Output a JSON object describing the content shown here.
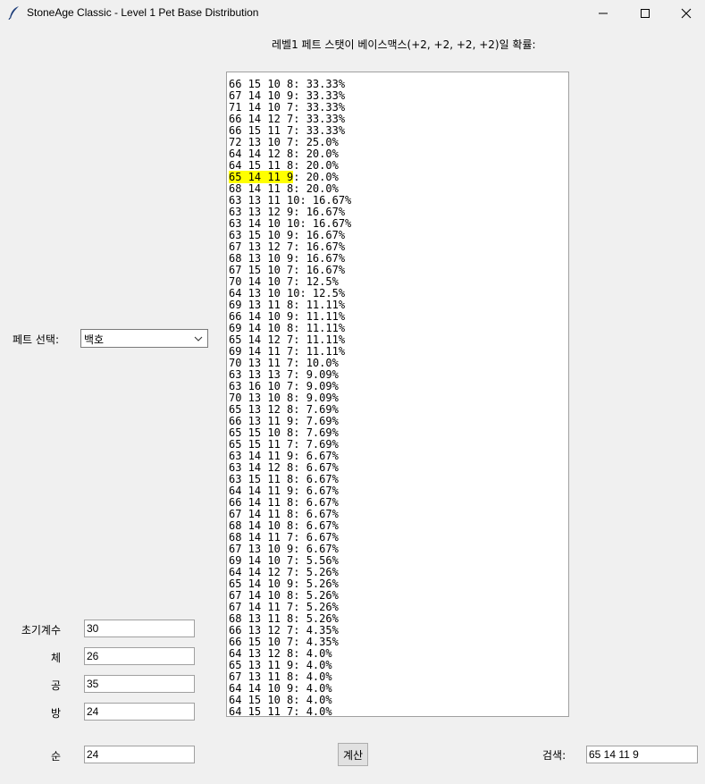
{
  "window": {
    "title": "StoneAge Classic - Level 1 Pet Base Distribution",
    "app_icon": "feather-icon"
  },
  "heading": "레벨1 페트 스탯이 베이스맥스(+2, +2, +2, +2)일 확률:",
  "pet_select": {
    "label": "페트 선택:",
    "value": "백호"
  },
  "fields": {
    "init_coef": {
      "label": "초기계수",
      "value": "30"
    },
    "vit": {
      "label": "체",
      "value": "26"
    },
    "atk": {
      "label": "공",
      "value": "35"
    },
    "def": {
      "label": "방",
      "value": "24"
    },
    "agi": {
      "label": "순",
      "value": "24"
    }
  },
  "calc_button": "계산",
  "search": {
    "label": "검색:",
    "value": "65 14 11 9"
  },
  "highlight_color": "#ffff00",
  "results": [
    "66 15 10 8: 33.33%",
    "67 14 10 9: 33.33%",
    "71 14 10 7: 33.33%",
    "66 14 12 7: 33.33%",
    "66 15 11 7: 33.33%",
    "72 13 10 7: 25.0%",
    "64 14 12 8: 20.0%",
    "64 15 11 8: 20.0%",
    "65 14 11 9: 20.0%",
    "68 14 11 8: 20.0%",
    "63 13 11 10: 16.67%",
    "63 13 12 9: 16.67%",
    "63 14 10 10: 16.67%",
    "63 15 10 9: 16.67%",
    "67 13 12 7: 16.67%",
    "68 13 10 9: 16.67%",
    "67 15 10 7: 16.67%",
    "70 14 10 7: 12.5%",
    "64 13 10 10: 12.5%",
    "69 13 11 8: 11.11%",
    "66 14 10 9: 11.11%",
    "69 14 10 8: 11.11%",
    "65 14 12 7: 11.11%",
    "69 14 11 7: 11.11%",
    "70 13 11 7: 10.0%",
    "63 13 13 7: 9.09%",
    "63 16 10 7: 9.09%",
    "70 13 10 8: 9.09%",
    "65 13 12 8: 7.69%",
    "66 13 11 9: 7.69%",
    "65 15 10 8: 7.69%",
    "65 15 11 7: 7.69%",
    "63 14 11 9: 6.67%",
    "63 14 12 8: 6.67%",
    "63 15 11 8: 6.67%",
    "64 14 11 9: 6.67%",
    "66 14 11 8: 6.67%",
    "67 14 11 8: 6.67%",
    "68 14 10 8: 6.67%",
    "68 14 11 7: 6.67%",
    "67 13 10 9: 6.67%",
    "69 14 10 7: 5.56%",
    "64 14 12 7: 5.26%",
    "65 14 10 9: 5.26%",
    "67 14 10 8: 5.26%",
    "67 14 11 7: 5.26%",
    "68 13 11 8: 5.26%",
    "66 13 12 7: 4.35%",
    "66 15 10 7: 4.35%",
    "64 13 12 8: 4.0%",
    "65 13 11 9: 4.0%",
    "67 13 11 8: 4.0%",
    "64 14 10 9: 4.0%",
    "64 15 10 8: 4.0%",
    "64 15 11 7: 4.0%"
  ],
  "highlighted_index": 8
}
